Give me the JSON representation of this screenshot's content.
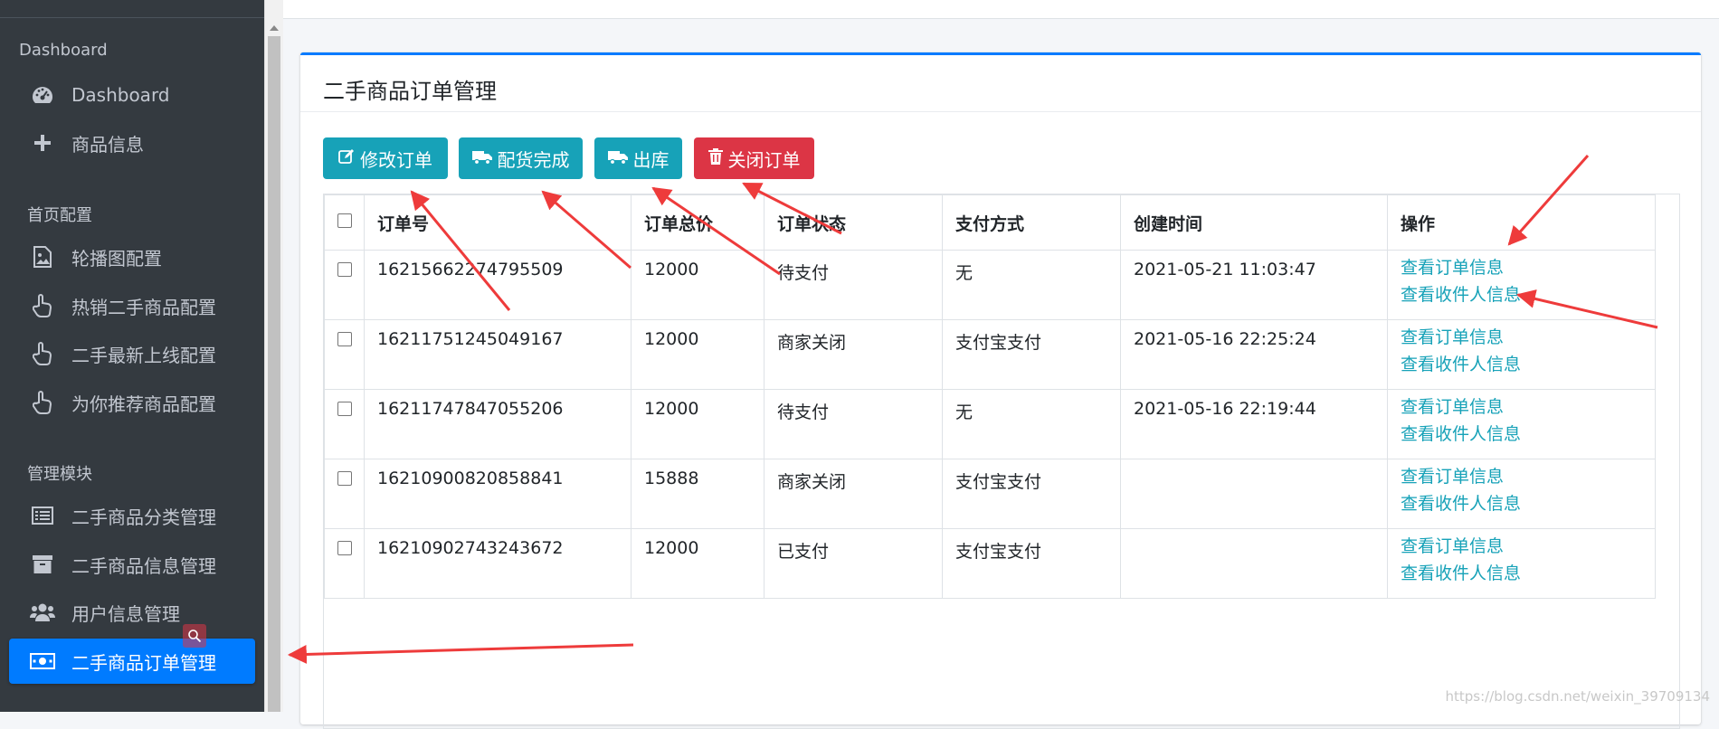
{
  "sidebar": {
    "sections": [
      {
        "title": "Dashboard",
        "items": [
          {
            "label": "Dashboard",
            "icon": "tachometer-icon"
          },
          {
            "label": "商品信息",
            "icon": "plus-icon"
          }
        ]
      },
      {
        "title": "首页配置",
        "items": [
          {
            "label": "轮播图配置",
            "icon": "image-icon"
          },
          {
            "label": "热销二手商品配置",
            "icon": "hand-pointer-icon"
          },
          {
            "label": "二手最新上线配置",
            "icon": "hand-pointer-icon"
          },
          {
            "label": "为你推荐商品配置",
            "icon": "hand-pointer-icon"
          }
        ]
      },
      {
        "title": "管理模块",
        "items": [
          {
            "label": "二手商品分类管理",
            "icon": "list-icon"
          },
          {
            "label": "二手商品信息管理",
            "icon": "archive-icon"
          },
          {
            "label": "用户信息管理",
            "icon": "users-icon"
          },
          {
            "label": "二手商品订单管理",
            "icon": "money-bill-icon",
            "active": true
          }
        ]
      }
    ]
  },
  "main": {
    "title": "二手商品订单管理",
    "toolbar": {
      "edit_label": "修改订单",
      "distribute_label": "配货完成",
      "ship_label": "出库",
      "close_label": "关闭订单"
    },
    "table": {
      "headers": [
        "订单号",
        "订单总价",
        "订单状态",
        "支付方式",
        "创建时间",
        "操作"
      ],
      "rows": [
        {
          "order_no": "16215662274795509",
          "total": "12000",
          "status": "待支付",
          "pay": "无",
          "created": "2021-05-21 11:03:47"
        },
        {
          "order_no": "16211751245049167",
          "total": "12000",
          "status": "商家关闭",
          "pay": "支付宝支付",
          "created": "2021-05-16 22:25:24"
        },
        {
          "order_no": "16211747847055206",
          "total": "12000",
          "status": "待支付",
          "pay": "无",
          "created": "2021-05-16 22:19:44"
        },
        {
          "order_no": "16210900820858841",
          "total": "15888",
          "status": "商家关闭",
          "pay": "支付宝支付",
          "created": ""
        },
        {
          "order_no": "16210902743243672",
          "total": "12000",
          "status": "已支付",
          "pay": "支付宝支付",
          "created": ""
        }
      ],
      "action_view_order": "查看订单信息",
      "action_view_receiver": "查看收件人信息"
    },
    "watermark": "https://blog.csdn.net/weixin_39709134"
  },
  "colors": {
    "sidebar_bg": "#343a40",
    "active": "#007bff",
    "info": "#17a2b8",
    "danger": "#dc3545",
    "annotation_arrow": "#ee3b3b"
  }
}
